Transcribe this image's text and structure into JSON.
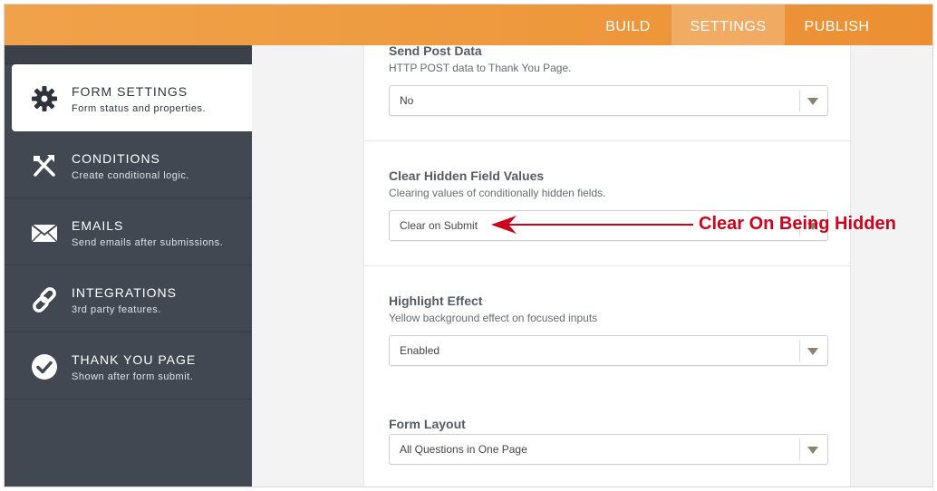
{
  "topbar": {
    "tabs": [
      {
        "label": "BUILD"
      },
      {
        "label": "SETTINGS"
      },
      {
        "label": "PUBLISH"
      }
    ]
  },
  "sidebar": {
    "items": [
      {
        "title": "FORM SETTINGS",
        "subtitle": "Form status and properties.",
        "icon": "gear-icon"
      },
      {
        "title": "CONDITIONS",
        "subtitle": "Create conditional logic.",
        "icon": "conditions-icon"
      },
      {
        "title": "EMAILS",
        "subtitle": "Send emails after submissions.",
        "icon": "envelope-icon"
      },
      {
        "title": "INTEGRATIONS",
        "subtitle": "3rd party features.",
        "icon": "link-icon"
      },
      {
        "title": "THANK YOU PAGE",
        "subtitle": "Shown after form submit.",
        "icon": "checkmark-icon"
      }
    ]
  },
  "settings": {
    "send_post_data": {
      "title": "Send Post Data",
      "description": "HTTP POST data to Thank You Page.",
      "value": "No"
    },
    "clear_hidden": {
      "title": "Clear Hidden Field Values",
      "description": "Clearing values of conditionally hidden fields.",
      "value": "Clear on Submit",
      "annotation": "Clear On Being Hidden"
    },
    "highlight": {
      "title": "Highlight Effect",
      "description": "Yellow background effect on focused inputs",
      "value": "Enabled"
    },
    "form_layout": {
      "title": "Form Layout",
      "value": "All Questions in One Page"
    }
  },
  "colors": {
    "accent": "#ee9a3f",
    "sidebar_bg": "#424852",
    "annotation": "#d0021b"
  }
}
